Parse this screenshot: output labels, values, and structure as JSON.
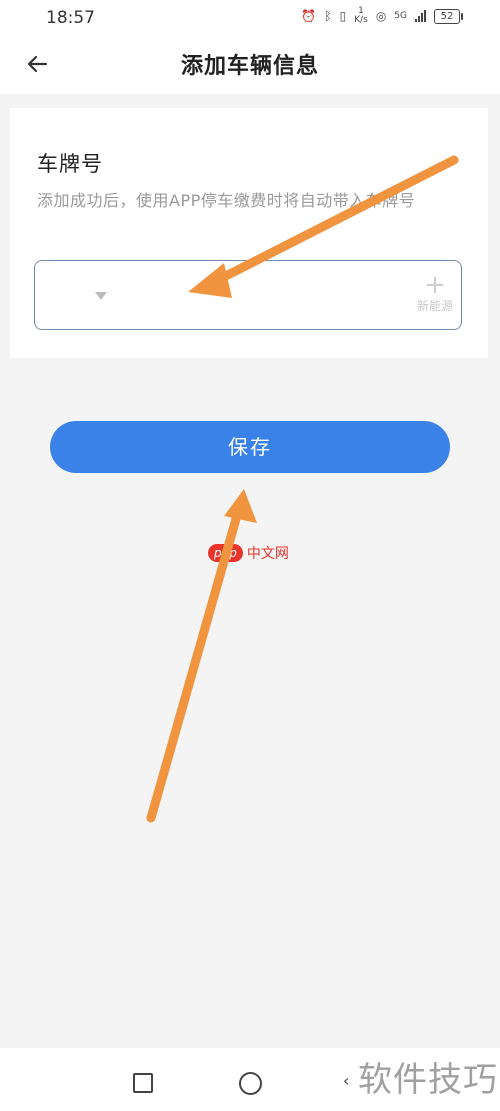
{
  "status_bar": {
    "time": "18:57",
    "net_speed_top": "1",
    "net_speed_unit": "K/s",
    "network_type": "5G",
    "battery": "52"
  },
  "header": {
    "title": "添加车辆信息",
    "back_icon": "back-arrow-icon"
  },
  "form": {
    "section_label": "车牌号",
    "hint": "添加成功后，使用APP停车缴费时将自动带入车牌号",
    "plate_value": "",
    "province_value": "",
    "new_energy_label": "新能源"
  },
  "actions": {
    "save_label": "保存"
  },
  "watermark": {
    "logo": "php",
    "site": "中文网",
    "corner_text": "软件技巧"
  },
  "annotations": {
    "arrow_color": "#f0943f"
  },
  "nav_bar": {
    "back_glyph": "‹"
  },
  "colors": {
    "accent": "#3b82e8",
    "background": "#f4f4f4"
  }
}
